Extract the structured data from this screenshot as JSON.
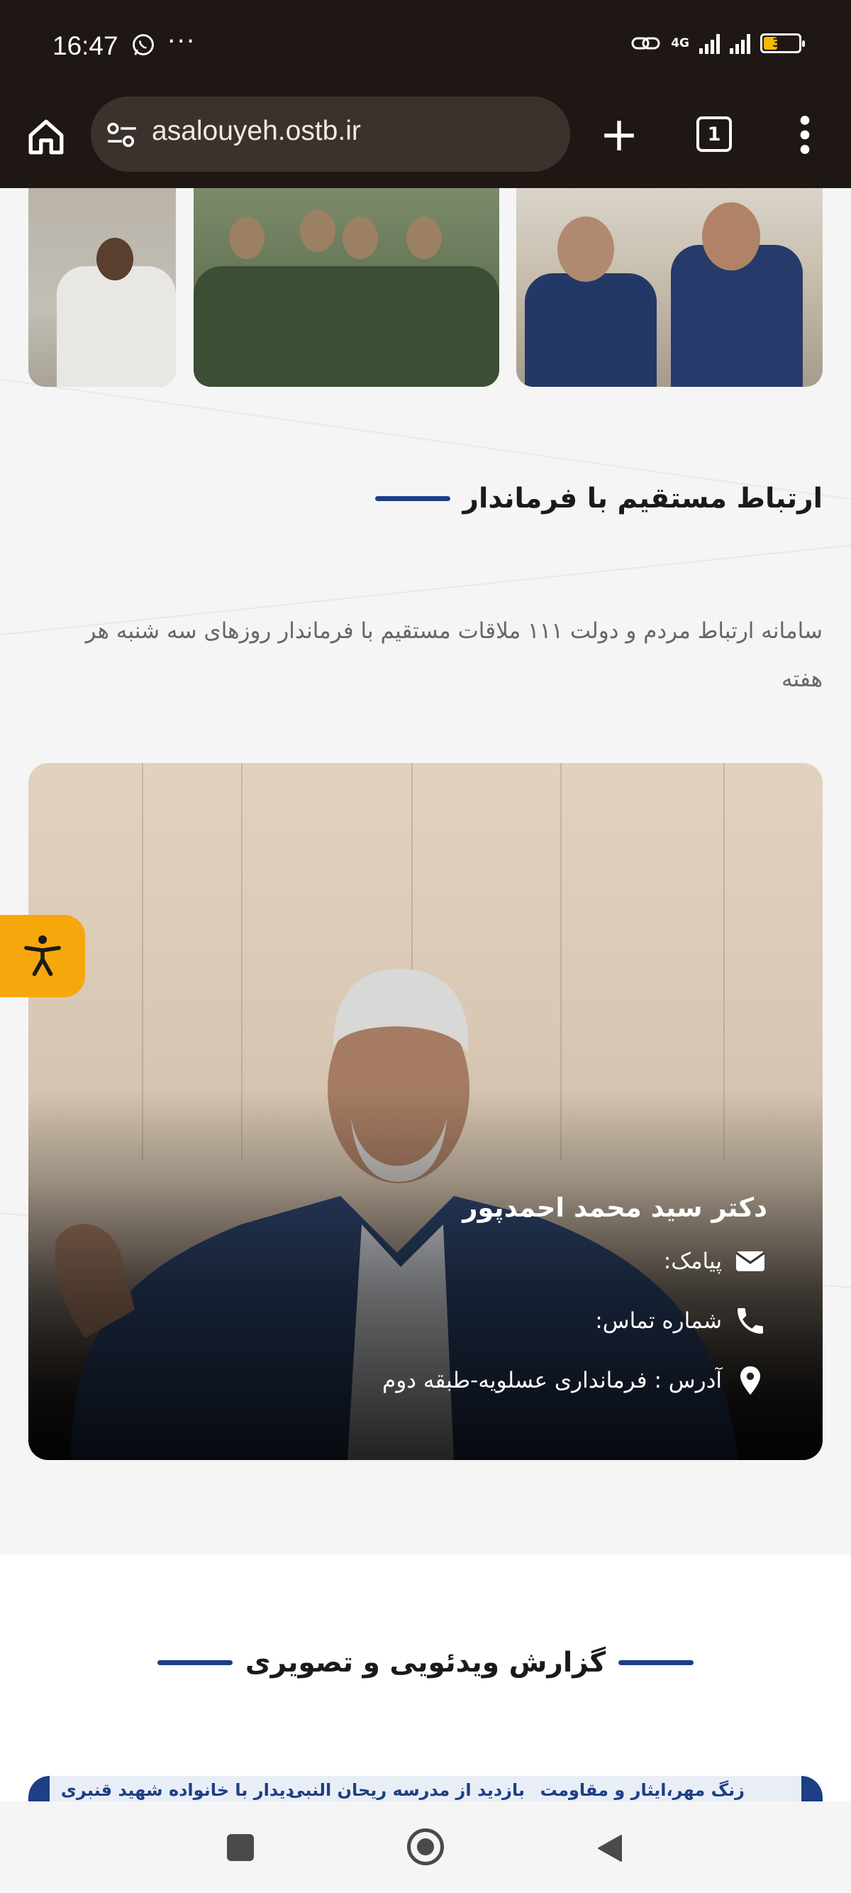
{
  "status_bar": {
    "time": "16:47",
    "dots": "···",
    "network": "4G",
    "battery": "36",
    "battery_level": 0.36
  },
  "browser": {
    "url": "asalouyeh.ostb.ir",
    "tab_count": "1"
  },
  "direct_contact": {
    "title": "ارتباط مستقیم با فرماندار",
    "description": "سامانه ارتباط مردم و دولت ۱۱۱ ملاقات مستقیم با فرماندار روزهای سه شنبه هر هفته"
  },
  "governor": {
    "name": "دکتر سید محمد احمدپور",
    "sms_label": "پیامک:",
    "phone_label": "شماره تماس:",
    "address_label": "آدرس : فرمانداری عسلویه-طبقه دوم"
  },
  "media_section": {
    "title": "گزارش ویدئویی و تصویری",
    "captions": [
      "زنگ مهر،ایثار و مقاومت",
      "بازدید از مدرسه ریحان النبی",
      "دیدار با خانواده شهید قنبری"
    ]
  },
  "colors": {
    "accent": "#1d3f86",
    "accessibility": "#f5a70b",
    "top_bar": "#1f1713"
  },
  "icons": [
    "whatsapp-icon",
    "link-icon",
    "home-icon",
    "tune-icon",
    "plus-icon",
    "menu-icon",
    "envelope-icon",
    "phone-icon",
    "location-icon",
    "accessibility-icon"
  ]
}
